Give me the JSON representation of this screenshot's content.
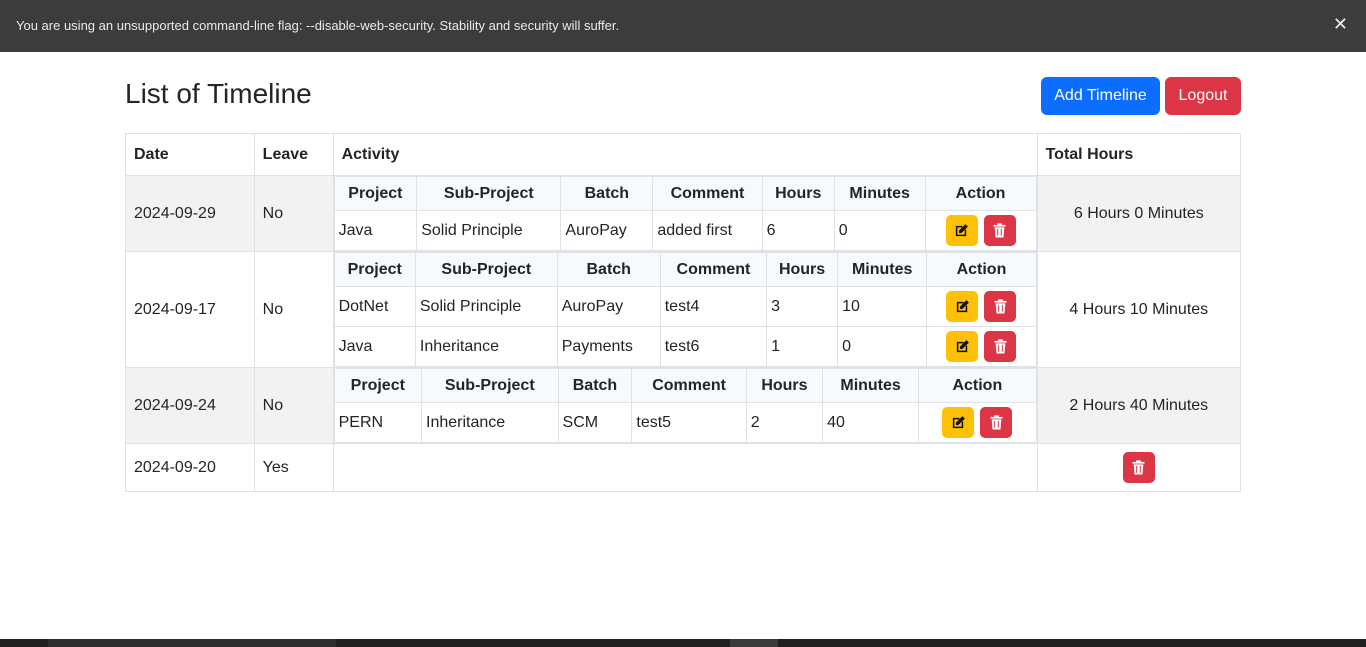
{
  "infobar": {
    "message": "You are using an unsupported command-line flag: --disable-web-security. Stability and security will suffer.",
    "close_symbol": "✕"
  },
  "page": {
    "title": "List of Timeline"
  },
  "buttons": {
    "add_timeline": "Add Timeline",
    "logout": "Logout"
  },
  "table": {
    "headers": {
      "date": "Date",
      "leave": "Leave",
      "activity": "Activity",
      "total_hours": "Total Hours"
    },
    "inner_headers": [
      "Project",
      "Sub-Project",
      "Batch",
      "Comment",
      "Hours",
      "Minutes",
      "Action"
    ],
    "rows": [
      {
        "date": "2024-09-29",
        "leave": "No",
        "total": "6 Hours 0 Minutes",
        "activities": [
          [
            "Java",
            "Solid Principle",
            "AuroPay",
            "added first",
            "6",
            "0"
          ]
        ]
      },
      {
        "date": "2024-09-17",
        "leave": "No",
        "total": "4 Hours 10 Minutes",
        "activities": [
          [
            "DotNet",
            "Solid Principle",
            "AuroPay",
            "test4",
            "3",
            "10"
          ],
          [
            "Java",
            "Inheritance",
            "Payments",
            "test6",
            "1",
            "0"
          ]
        ]
      },
      {
        "date": "2024-09-24",
        "leave": "No",
        "total": "2 Hours 40 Minutes",
        "activities": [
          [
            "PERN",
            "Inheritance",
            "SCM",
            "test5",
            "2",
            "40"
          ]
        ]
      },
      {
        "date": "2024-09-20",
        "leave": "Yes",
        "total": "",
        "activities": []
      }
    ]
  },
  "colors": {
    "primary": "#0d6efd",
    "danger": "#dc3545",
    "warning": "#ffc107",
    "infobar_bg": "#3c3c3c",
    "stripe": "#f2f2f2"
  },
  "icons": {
    "edit": "edit-icon",
    "delete": "trash-icon",
    "close": "close-icon"
  }
}
